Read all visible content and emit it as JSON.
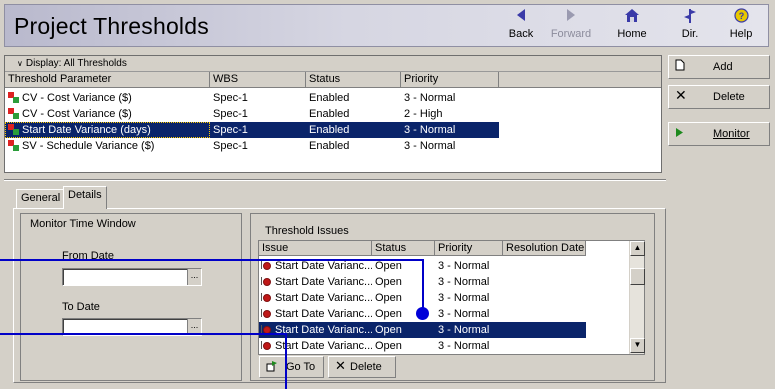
{
  "app": {
    "title": "Project Thresholds"
  },
  "toolbar": [
    {
      "label": "Back",
      "icon": "back-arrow-icon",
      "enabled": true
    },
    {
      "label": "Forward",
      "icon": "forward-arrow-icon",
      "enabled": false
    },
    {
      "label": "Home",
      "icon": "home-icon",
      "enabled": true
    },
    {
      "label": "Dir.",
      "icon": "directory-icon",
      "enabled": true
    },
    {
      "label": "Help",
      "icon": "help-icon",
      "enabled": true
    }
  ],
  "display_filter": "Display: All Thresholds",
  "thresholds": {
    "columns": [
      "Threshold Parameter",
      "WBS",
      "Status",
      "Priority"
    ],
    "rows": [
      {
        "parameter": "CV - Cost Variance ($)",
        "wbs": "Spec-1",
        "status": "Enabled",
        "priority": "3 - Normal"
      },
      {
        "parameter": "CV - Cost Variance ($)",
        "wbs": "Spec-1",
        "status": "Enabled",
        "priority": "2 - High"
      },
      {
        "parameter": "Start Date Variance (days)",
        "wbs": "Spec-1",
        "status": "Enabled",
        "priority": "3 - Normal",
        "selected": true
      },
      {
        "parameter": "SV - Schedule Variance ($)",
        "wbs": "Spec-1",
        "status": "Enabled",
        "priority": "3 - Normal"
      }
    ]
  },
  "side_buttons": [
    {
      "label": "Add",
      "icon": "document-icon"
    },
    {
      "label": "Delete",
      "icon": "x-icon"
    },
    {
      "label": "Monitor",
      "icon": "play-icon"
    }
  ],
  "tabs": [
    {
      "label": "General",
      "active": false
    },
    {
      "label": "Details",
      "active": true
    }
  ],
  "monitor_window": {
    "title": "Monitor Time Window",
    "from_label": "From Date",
    "from_value": "",
    "to_label": "To Date",
    "to_value": "",
    "picker_glyph": "..."
  },
  "issues": {
    "title": "Threshold Issues",
    "columns": [
      "Issue",
      "Status",
      "Priority",
      "Resolution Date"
    ],
    "rows": [
      {
        "issue": "Start Date Varianc...",
        "status": "Open",
        "priority": "3 - Normal",
        "resolution": ""
      },
      {
        "issue": "Start Date Varianc...",
        "status": "Open",
        "priority": "3 - Normal",
        "resolution": ""
      },
      {
        "issue": "Start Date Varianc...",
        "status": "Open",
        "priority": "3 - Normal",
        "resolution": ""
      },
      {
        "issue": "Start Date Varianc...",
        "status": "Open",
        "priority": "3 - Normal",
        "resolution": ""
      },
      {
        "issue": "Start Date Varianc...",
        "status": "Open",
        "priority": "3 - Normal",
        "resolution": "",
        "selected": true
      },
      {
        "issue": "Start Date Varianc...",
        "status": "Open",
        "priority": "3 - Normal",
        "resolution": ""
      }
    ],
    "goto_label": "Go To",
    "delete_label": "Delete"
  },
  "colors": {
    "selection": "#0a246a",
    "callout": "#0000c8",
    "chrome": "#d4d0c8"
  }
}
